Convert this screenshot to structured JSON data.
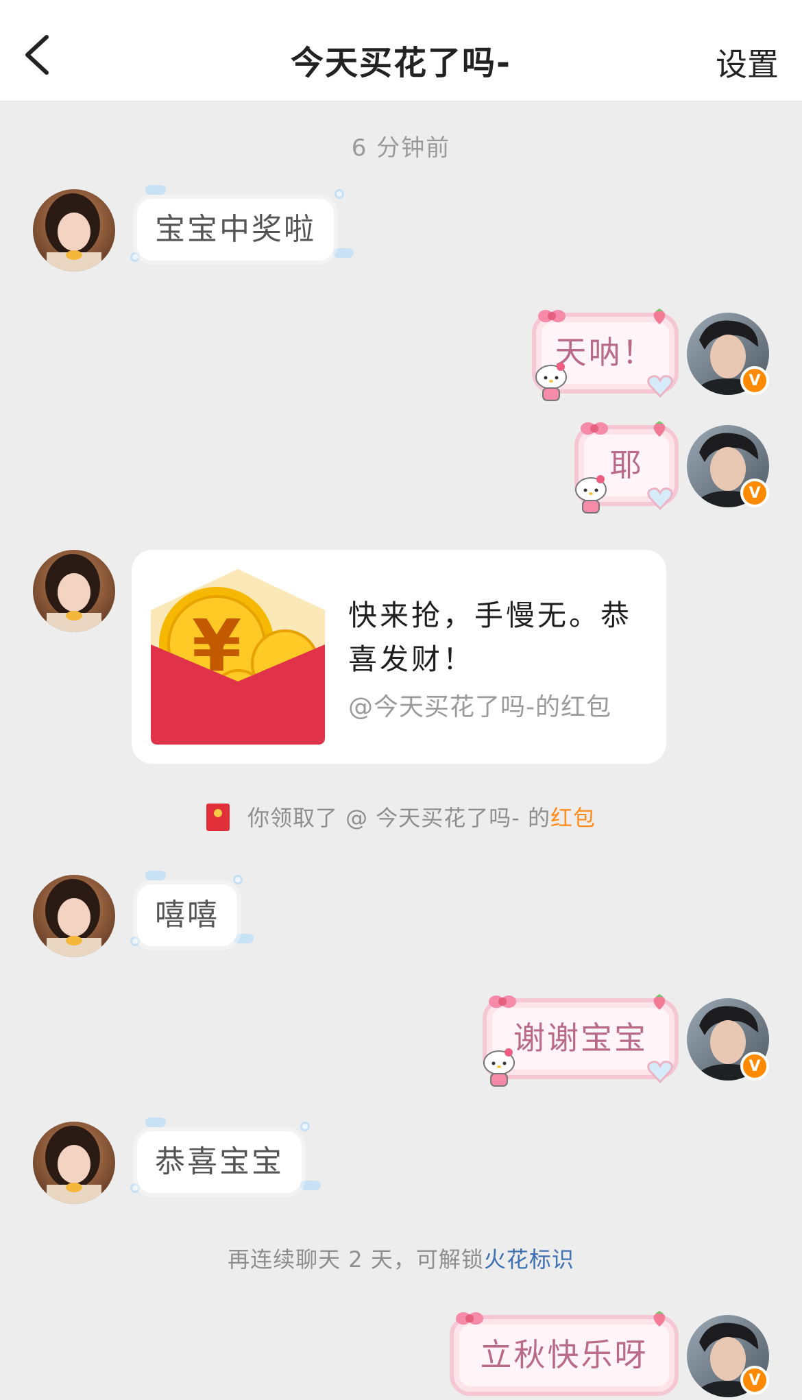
{
  "header": {
    "title": "今天买花了吗-",
    "settings_label": "设置"
  },
  "timestamp": "6 分钟前",
  "messages": [
    {
      "side": "in",
      "text": "宝宝中奖啦"
    },
    {
      "side": "out",
      "text": "天呐！"
    },
    {
      "side": "out",
      "text": "耶"
    },
    {
      "side": "in",
      "text": "嘻嘻"
    },
    {
      "side": "out",
      "text": "谢谢宝宝"
    },
    {
      "side": "in",
      "text": "恭喜宝宝"
    },
    {
      "side": "out",
      "text": "立秋快乐呀"
    }
  ],
  "red_packet": {
    "message": "快来抢，手慢无。恭喜发财！",
    "sender_label": "@今天买花了吗-的红包"
  },
  "received_notice": {
    "prefix": "你领取了 @ 今天买花了吗- 的",
    "link": "红包"
  },
  "streak_notice": {
    "prefix": "再连续聊天 2 天，可解锁",
    "link": "火花标识"
  },
  "badge_letter": "V",
  "colors": {
    "accent_orange": "#ff8c1a",
    "link_blue": "#3d6fb3",
    "packet_red": "#e2303a"
  }
}
